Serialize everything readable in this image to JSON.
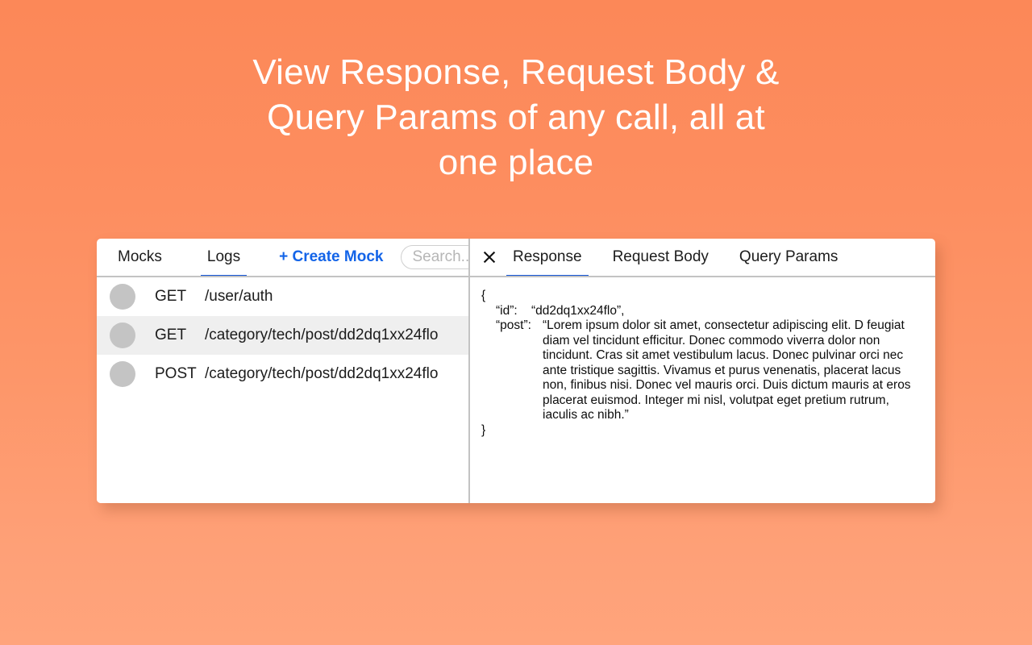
{
  "headline": "View Response, Request Body &\nQuery Params of any call, all at\none place",
  "colors": {
    "background_top": "#fc8858",
    "background_bottom": "#ffa47c",
    "accent_blue": "#1355d6",
    "link_blue": "#1364e8",
    "row_selected": "#efefef",
    "dot_gray": "#c4c4c4",
    "border_gray": "#c3c3c3"
  },
  "left_panel": {
    "tabs": [
      {
        "label": "Mocks",
        "active": false
      },
      {
        "label": "Logs",
        "active": true
      }
    ],
    "create_mock_label": "+ Create Mock",
    "search": {
      "placeholder": "Search...",
      "value": ""
    },
    "rows": [
      {
        "status_icon": "status-dot-icon",
        "method": "GET",
        "path": "/user/auth",
        "selected": false
      },
      {
        "status_icon": "status-dot-icon",
        "method": "GET",
        "path": "/category/tech/post/dd2dq1xx24flo",
        "selected": true
      },
      {
        "status_icon": "status-dot-icon",
        "method": "POST",
        "path": "/category/tech/post/dd2dq1xx24flo",
        "selected": false
      }
    ]
  },
  "right_panel": {
    "close_icon": "close-icon",
    "tabs": [
      {
        "label": "Response",
        "active": true
      },
      {
        "label": "Request Body",
        "active": false
      },
      {
        "label": "Query Params",
        "active": false
      }
    ],
    "json": {
      "open_brace": "{",
      "close_brace": "}",
      "fields": [
        {
          "key": "“id”:",
          "value": "“dd2dq1xx24flo”,",
          "multiline": false
        },
        {
          "key": "“post”:",
          "value": "“Lorem ipsum dolor sit amet, consectetur adipiscing elit. D feugiat diam vel tincidunt efficitur. Donec commodo viverra dolor non tincidunt. Cras sit amet vestibulum lacus. Donec pulvinar orci nec ante tristique sagittis. Vivamus et purus venenatis, placerat lacus non, finibus nisi. Donec vel mauris orci. Duis dictum mauris at eros placerat euismod. Integer mi nisl, volutpat eget pretium rutrum, iaculis ac nibh.”",
          "multiline": true
        }
      ]
    }
  }
}
